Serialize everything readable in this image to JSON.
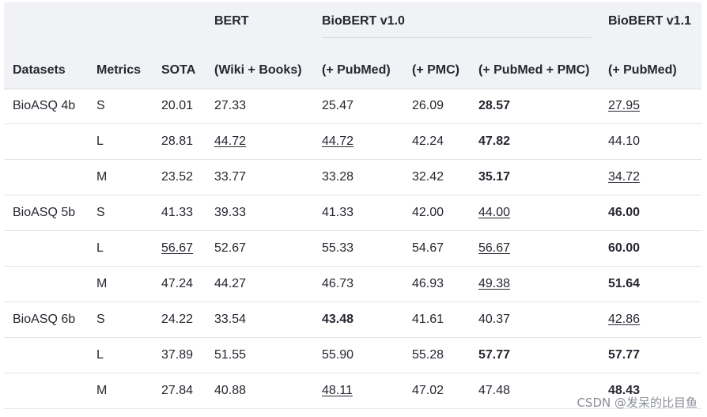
{
  "groups": [
    {
      "label": "BERT"
    },
    {
      "label": "BioBERT v1.0"
    },
    {
      "label": "BioBERT v1.1"
    }
  ],
  "columns": [
    {
      "label": "Datasets"
    },
    {
      "label": "Metrics"
    },
    {
      "label": "SOTA"
    },
    {
      "label": "(Wiki + Books)"
    },
    {
      "label": "(+ PubMed)"
    },
    {
      "label": "(+ PMC)"
    },
    {
      "label": "(+ PubMed + PMC)"
    },
    {
      "label": "(+ PubMed)"
    }
  ],
  "rows": [
    {
      "cells": [
        {
          "v": "BioASQ 4b"
        },
        {
          "v": "S"
        },
        {
          "v": "20.01"
        },
        {
          "v": "27.33"
        },
        {
          "v": "25.47"
        },
        {
          "v": "26.09"
        },
        {
          "v": "28.57",
          "style": "bold"
        },
        {
          "v": "27.95",
          "style": "underline"
        }
      ]
    },
    {
      "cells": [
        {
          "v": ""
        },
        {
          "v": "L"
        },
        {
          "v": "28.81"
        },
        {
          "v": "44.72",
          "style": "underline"
        },
        {
          "v": "44.72",
          "style": "underline"
        },
        {
          "v": "42.24"
        },
        {
          "v": "47.82",
          "style": "bold"
        },
        {
          "v": "44.10"
        }
      ]
    },
    {
      "cells": [
        {
          "v": ""
        },
        {
          "v": "M"
        },
        {
          "v": "23.52"
        },
        {
          "v": "33.77"
        },
        {
          "v": "33.28"
        },
        {
          "v": "32.42"
        },
        {
          "v": "35.17",
          "style": "bold"
        },
        {
          "v": "34.72",
          "style": "underline"
        }
      ]
    },
    {
      "cells": [
        {
          "v": "BioASQ 5b"
        },
        {
          "v": "S"
        },
        {
          "v": "41.33"
        },
        {
          "v": "39.33"
        },
        {
          "v": "41.33"
        },
        {
          "v": "42.00"
        },
        {
          "v": "44.00",
          "style": "underline"
        },
        {
          "v": "46.00",
          "style": "bold"
        }
      ]
    },
    {
      "cells": [
        {
          "v": ""
        },
        {
          "v": "L"
        },
        {
          "v": "56.67",
          "style": "underline"
        },
        {
          "v": "52.67"
        },
        {
          "v": "55.33"
        },
        {
          "v": "54.67"
        },
        {
          "v": "56.67",
          "style": "underline"
        },
        {
          "v": "60.00",
          "style": "bold"
        }
      ]
    },
    {
      "cells": [
        {
          "v": ""
        },
        {
          "v": "M"
        },
        {
          "v": "47.24"
        },
        {
          "v": "44.27"
        },
        {
          "v": "46.73"
        },
        {
          "v": "46.93"
        },
        {
          "v": "49.38",
          "style": "underline"
        },
        {
          "v": "51.64",
          "style": "bold"
        }
      ]
    },
    {
      "cells": [
        {
          "v": "BioASQ 6b"
        },
        {
          "v": "S"
        },
        {
          "v": "24.22"
        },
        {
          "v": "33.54"
        },
        {
          "v": "43.48",
          "style": "bold"
        },
        {
          "v": "41.61"
        },
        {
          "v": "40.37"
        },
        {
          "v": "42.86",
          "style": "underline"
        }
      ]
    },
    {
      "cells": [
        {
          "v": ""
        },
        {
          "v": "L"
        },
        {
          "v": "37.89"
        },
        {
          "v": "51.55"
        },
        {
          "v": "55.90"
        },
        {
          "v": "55.28"
        },
        {
          "v": "57.77",
          "style": "bold"
        },
        {
          "v": "57.77",
          "style": "bold"
        }
      ]
    },
    {
      "cells": [
        {
          "v": ""
        },
        {
          "v": "M"
        },
        {
          "v": "27.84"
        },
        {
          "v": "40.88"
        },
        {
          "v": "48.11",
          "style": "underline"
        },
        {
          "v": "47.02"
        },
        {
          "v": "47.48"
        },
        {
          "v": "48.43",
          "style": "bold"
        }
      ]
    }
  ],
  "watermark": "CSDN @发呆的比目鱼"
}
